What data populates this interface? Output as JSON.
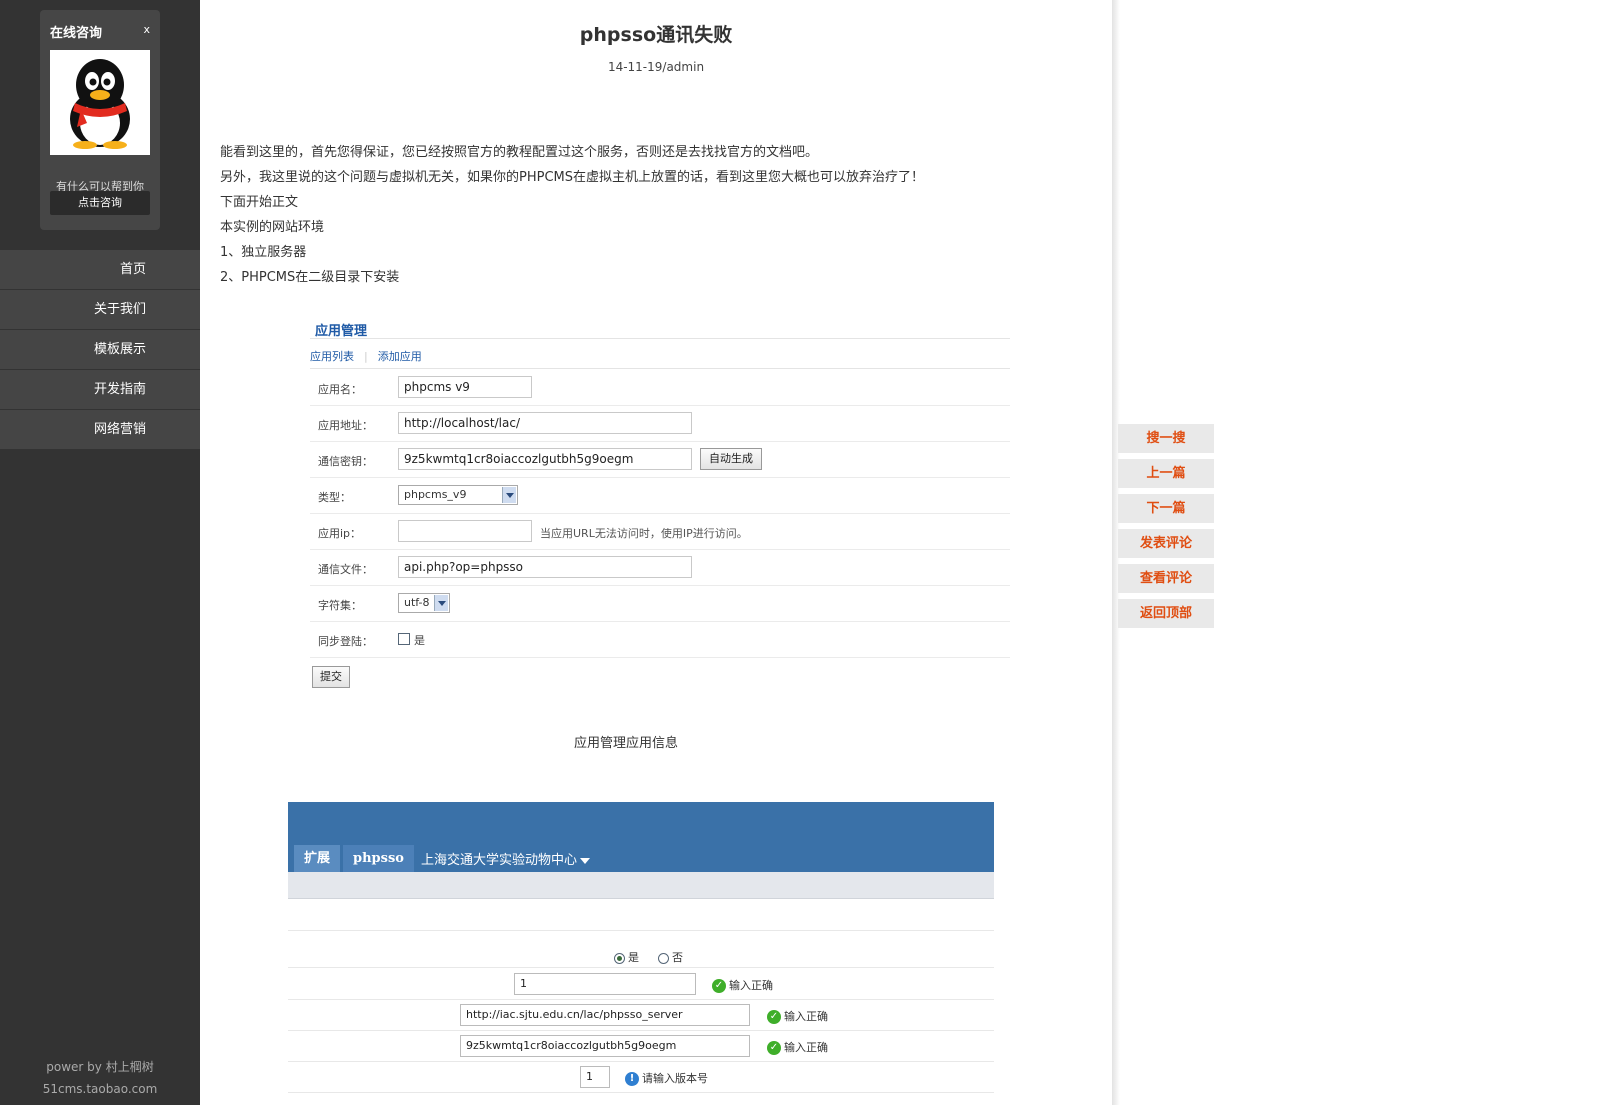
{
  "sidebar": {
    "consult_title": "在线咨询",
    "consult_close": "x",
    "consult_help": "有什么可以帮到你",
    "consult_button": "点击咨询",
    "nav": [
      "首页",
      "关于我们",
      "模板展示",
      "开发指南",
      "网络营销"
    ],
    "powered": "power by 村上棡树",
    "shop": "51cms.taobao.com"
  },
  "article": {
    "title": "phpsso通讯失败",
    "meta": "14-11-19/admin",
    "paragraphs": [
      "能看到这里的，首先您得保证，您已经按照官方的教程配置过这个服务，否则还是去找找官方的文档吧。",
      "另外，我这里说的这个问题与虚拟机无关，如果你的PHPCMS在虚拟主机上放置的话，看到这里您大概也可以放弃治疗了！",
      "下面开始正文",
      "本实例的网站环境",
      "1、独立服务器",
      "2、PHPCMS在二级目录下安装"
    ],
    "caption2": "应用管理应用信息"
  },
  "shot1": {
    "heading": "应用管理",
    "tab_list": "应用列表",
    "tab_add": "添加应用",
    "rows": {
      "app_name": {
        "label": "应用名：",
        "value": "phpcms v9"
      },
      "app_url": {
        "label": "应用地址：",
        "value": "http://localhost/lac/"
      },
      "auth_key": {
        "label": "通信密钥：",
        "value": "9z5kwmtq1cr8oiaccozlgutbh5g9oegm",
        "button": "自动生成"
      },
      "type": {
        "label": "类型：",
        "value": "phpcms_v9"
      },
      "app_ip": {
        "label": "应用ip：",
        "value": "",
        "hint": "当应用URL无法访问时，使用IP进行访问。"
      },
      "api_file": {
        "label": "通信文件：",
        "value": "api.php?op=phpsso"
      },
      "charset": {
        "label": "字符集：",
        "value": "utf-8"
      },
      "sync_login": {
        "label": "同步登陆：",
        "option": "是"
      }
    },
    "submit": "提交"
  },
  "shot2": {
    "tab_ext": "扩展",
    "tab_phpsso": "phpsso",
    "site": "上海交通大学实验动物中心",
    "radio_yes": "是",
    "radio_no": "否",
    "field1": "1",
    "field2": "http://iac.sjtu.edu.cn/lac/phpsso_server",
    "field3": "9z5kwmtq1cr8oiaccozlgutbh5g9oegm",
    "field4": "1",
    "ok_text": "输入正确",
    "version_hint": "请输入版本号"
  },
  "float_buttons": [
    "搜一搜",
    "上一篇",
    "下一篇",
    "发表评论",
    "查看评论",
    "返回顶部"
  ]
}
